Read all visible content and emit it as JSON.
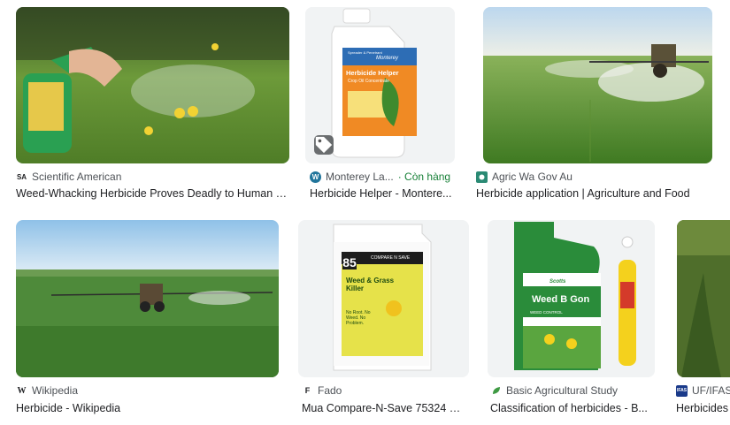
{
  "results": [
    {
      "source": "Scientific American",
      "favicon_text": "SA",
      "title": "Weed-Whacking Herbicide Proves Deadly to Human C..."
    },
    {
      "source": "Monterey La...",
      "favicon_text": "W",
      "stock": "· Còn hàng",
      "title": "Herbicide Helper - Montere...",
      "label": {
        "brand": "Monterey",
        "sub": "Spreader & Penetrant",
        "name": "Herbicide Helper",
        "desc": "Crop Oil Concentrate"
      }
    },
    {
      "source": "Agric Wa Gov Au",
      "favicon_text": "",
      "title": "Herbicide application | Agriculture and Food"
    },
    {
      "source": "Wikipedia",
      "favicon_text": "W",
      "title": "Herbicide - Wikipedia"
    },
    {
      "source": "Fado",
      "favicon_text": "F",
      "title": "Mua Compare-N-Save 75324 He...",
      "label": {
        "badge": "85",
        "banner": "COMPARE N SAVE",
        "name": "Weed & Grass Killer",
        "claims": "No Root. No Weed. No Problem."
      }
    },
    {
      "source": "Basic Agricultural Study",
      "favicon_text": "",
      "title": "Classification of herbicides - B...",
      "label": {
        "brand": "Scotts",
        "name": "Weed B Gon",
        "desc": "WEED CONTROL"
      }
    },
    {
      "source": "UF/IFAS",
      "favicon_text": "IFAS",
      "title": "Herbicides"
    }
  ],
  "colors": {
    "stock_green": "#188038",
    "text": "#202124",
    "meta": "#4d5156"
  }
}
